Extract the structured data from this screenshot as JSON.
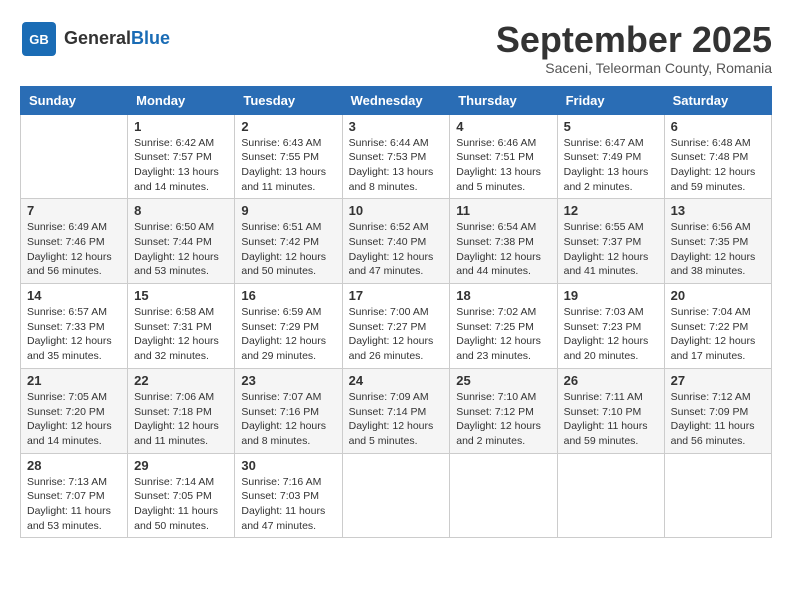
{
  "logo": {
    "general": "General",
    "blue": "Blue"
  },
  "title": "September 2025",
  "location": "Saceni, Teleorman County, Romania",
  "headers": [
    "Sunday",
    "Monday",
    "Tuesday",
    "Wednesday",
    "Thursday",
    "Friday",
    "Saturday"
  ],
  "weeks": [
    [
      {
        "day": "",
        "sunrise": "",
        "sunset": "",
        "daylight": ""
      },
      {
        "day": "1",
        "sunrise": "Sunrise: 6:42 AM",
        "sunset": "Sunset: 7:57 PM",
        "daylight": "Daylight: 13 hours and 14 minutes."
      },
      {
        "day": "2",
        "sunrise": "Sunrise: 6:43 AM",
        "sunset": "Sunset: 7:55 PM",
        "daylight": "Daylight: 13 hours and 11 minutes."
      },
      {
        "day": "3",
        "sunrise": "Sunrise: 6:44 AM",
        "sunset": "Sunset: 7:53 PM",
        "daylight": "Daylight: 13 hours and 8 minutes."
      },
      {
        "day": "4",
        "sunrise": "Sunrise: 6:46 AM",
        "sunset": "Sunset: 7:51 PM",
        "daylight": "Daylight: 13 hours and 5 minutes."
      },
      {
        "day": "5",
        "sunrise": "Sunrise: 6:47 AM",
        "sunset": "Sunset: 7:49 PM",
        "daylight": "Daylight: 13 hours and 2 minutes."
      },
      {
        "day": "6",
        "sunrise": "Sunrise: 6:48 AM",
        "sunset": "Sunset: 7:48 PM",
        "daylight": "Daylight: 12 hours and 59 minutes."
      }
    ],
    [
      {
        "day": "7",
        "sunrise": "Sunrise: 6:49 AM",
        "sunset": "Sunset: 7:46 PM",
        "daylight": "Daylight: 12 hours and 56 minutes."
      },
      {
        "day": "8",
        "sunrise": "Sunrise: 6:50 AM",
        "sunset": "Sunset: 7:44 PM",
        "daylight": "Daylight: 12 hours and 53 minutes."
      },
      {
        "day": "9",
        "sunrise": "Sunrise: 6:51 AM",
        "sunset": "Sunset: 7:42 PM",
        "daylight": "Daylight: 12 hours and 50 minutes."
      },
      {
        "day": "10",
        "sunrise": "Sunrise: 6:52 AM",
        "sunset": "Sunset: 7:40 PM",
        "daylight": "Daylight: 12 hours and 47 minutes."
      },
      {
        "day": "11",
        "sunrise": "Sunrise: 6:54 AM",
        "sunset": "Sunset: 7:38 PM",
        "daylight": "Daylight: 12 hours and 44 minutes."
      },
      {
        "day": "12",
        "sunrise": "Sunrise: 6:55 AM",
        "sunset": "Sunset: 7:37 PM",
        "daylight": "Daylight: 12 hours and 41 minutes."
      },
      {
        "day": "13",
        "sunrise": "Sunrise: 6:56 AM",
        "sunset": "Sunset: 7:35 PM",
        "daylight": "Daylight: 12 hours and 38 minutes."
      }
    ],
    [
      {
        "day": "14",
        "sunrise": "Sunrise: 6:57 AM",
        "sunset": "Sunset: 7:33 PM",
        "daylight": "Daylight: 12 hours and 35 minutes."
      },
      {
        "day": "15",
        "sunrise": "Sunrise: 6:58 AM",
        "sunset": "Sunset: 7:31 PM",
        "daylight": "Daylight: 12 hours and 32 minutes."
      },
      {
        "day": "16",
        "sunrise": "Sunrise: 6:59 AM",
        "sunset": "Sunset: 7:29 PM",
        "daylight": "Daylight: 12 hours and 29 minutes."
      },
      {
        "day": "17",
        "sunrise": "Sunrise: 7:00 AM",
        "sunset": "Sunset: 7:27 PM",
        "daylight": "Daylight: 12 hours and 26 minutes."
      },
      {
        "day": "18",
        "sunrise": "Sunrise: 7:02 AM",
        "sunset": "Sunset: 7:25 PM",
        "daylight": "Daylight: 12 hours and 23 minutes."
      },
      {
        "day": "19",
        "sunrise": "Sunrise: 7:03 AM",
        "sunset": "Sunset: 7:23 PM",
        "daylight": "Daylight: 12 hours and 20 minutes."
      },
      {
        "day": "20",
        "sunrise": "Sunrise: 7:04 AM",
        "sunset": "Sunset: 7:22 PM",
        "daylight": "Daylight: 12 hours and 17 minutes."
      }
    ],
    [
      {
        "day": "21",
        "sunrise": "Sunrise: 7:05 AM",
        "sunset": "Sunset: 7:20 PM",
        "daylight": "Daylight: 12 hours and 14 minutes."
      },
      {
        "day": "22",
        "sunrise": "Sunrise: 7:06 AM",
        "sunset": "Sunset: 7:18 PM",
        "daylight": "Daylight: 12 hours and 11 minutes."
      },
      {
        "day": "23",
        "sunrise": "Sunrise: 7:07 AM",
        "sunset": "Sunset: 7:16 PM",
        "daylight": "Daylight: 12 hours and 8 minutes."
      },
      {
        "day": "24",
        "sunrise": "Sunrise: 7:09 AM",
        "sunset": "Sunset: 7:14 PM",
        "daylight": "Daylight: 12 hours and 5 minutes."
      },
      {
        "day": "25",
        "sunrise": "Sunrise: 7:10 AM",
        "sunset": "Sunset: 7:12 PM",
        "daylight": "Daylight: 12 hours and 2 minutes."
      },
      {
        "day": "26",
        "sunrise": "Sunrise: 7:11 AM",
        "sunset": "Sunset: 7:10 PM",
        "daylight": "Daylight: 11 hours and 59 minutes."
      },
      {
        "day": "27",
        "sunrise": "Sunrise: 7:12 AM",
        "sunset": "Sunset: 7:09 PM",
        "daylight": "Daylight: 11 hours and 56 minutes."
      }
    ],
    [
      {
        "day": "28",
        "sunrise": "Sunrise: 7:13 AM",
        "sunset": "Sunset: 7:07 PM",
        "daylight": "Daylight: 11 hours and 53 minutes."
      },
      {
        "day": "29",
        "sunrise": "Sunrise: 7:14 AM",
        "sunset": "Sunset: 7:05 PM",
        "daylight": "Daylight: 11 hours and 50 minutes."
      },
      {
        "day": "30",
        "sunrise": "Sunrise: 7:16 AM",
        "sunset": "Sunset: 7:03 PM",
        "daylight": "Daylight: 11 hours and 47 minutes."
      },
      {
        "day": "",
        "sunrise": "",
        "sunset": "",
        "daylight": ""
      },
      {
        "day": "",
        "sunrise": "",
        "sunset": "",
        "daylight": ""
      },
      {
        "day": "",
        "sunrise": "",
        "sunset": "",
        "daylight": ""
      },
      {
        "day": "",
        "sunrise": "",
        "sunset": "",
        "daylight": ""
      }
    ]
  ]
}
